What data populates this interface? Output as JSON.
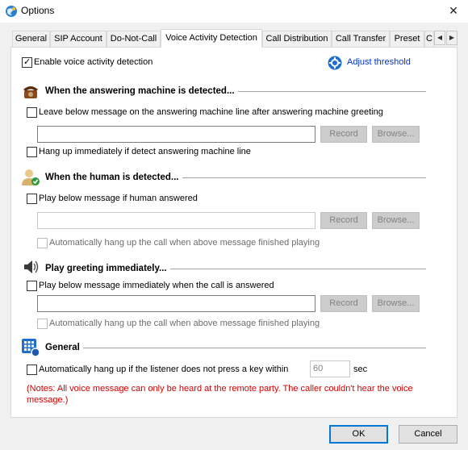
{
  "window": {
    "title": "Options",
    "close_glyph": "✕"
  },
  "tabs": [
    {
      "label": "General"
    },
    {
      "label": "SIP Account"
    },
    {
      "label": "Do-Not-Call"
    },
    {
      "label": "Voice Activity Detection",
      "active": true
    },
    {
      "label": "Call Distribution"
    },
    {
      "label": "Call Transfer"
    },
    {
      "label": "Preset"
    },
    {
      "label": "C"
    }
  ],
  "tab_scroll": {
    "left": "◀",
    "right": "▶"
  },
  "vad": {
    "enable_label": "Enable voice activity detection",
    "enable_checked": true,
    "adjust_threshold": "Adjust threshold"
  },
  "machine": {
    "title": "When the answering machine is detected...",
    "leave_message_label": "Leave below message on the answering machine line after answering machine greeting",
    "message_value": "",
    "record_label": "Record",
    "browse_label": "Browse...",
    "hangup_label": "Hang up immediately if detect answering machine line"
  },
  "human": {
    "title": "When the human is detected...",
    "play_label": "Play below message if human answered",
    "message_value": "",
    "record_label": "Record",
    "browse_label": "Browse...",
    "auto_hangup_label": "Automatically hang up the call when above message finished playing"
  },
  "greeting": {
    "title": "Play greeting immediately...",
    "play_label": "Play below message immediately when the call is answered",
    "message_value": "",
    "record_label": "Record",
    "browse_label": "Browse...",
    "auto_hangup_label": "Automatically hang up the call when above message finished playing"
  },
  "general": {
    "title": "General",
    "auto_hangup_key_label": "Automatically hang up if the listener does not press a key within",
    "seconds_value": "60",
    "seconds_unit": "sec"
  },
  "note": "(Notes: All voice message can only be heard at the remote party. The caller couldn't hear the voice message.)",
  "footer": {
    "ok_label": "OK",
    "cancel_label": "Cancel"
  },
  "colors": {
    "link": "#0033cc",
    "note": "#d40000",
    "accent": "#0078d7"
  },
  "icons": {
    "app": "globe-icon",
    "machine": "telephone-icon",
    "human": "user-icon",
    "greeting": "speaker-icon",
    "general": "keypad-icon",
    "threshold": "gear-icon"
  }
}
